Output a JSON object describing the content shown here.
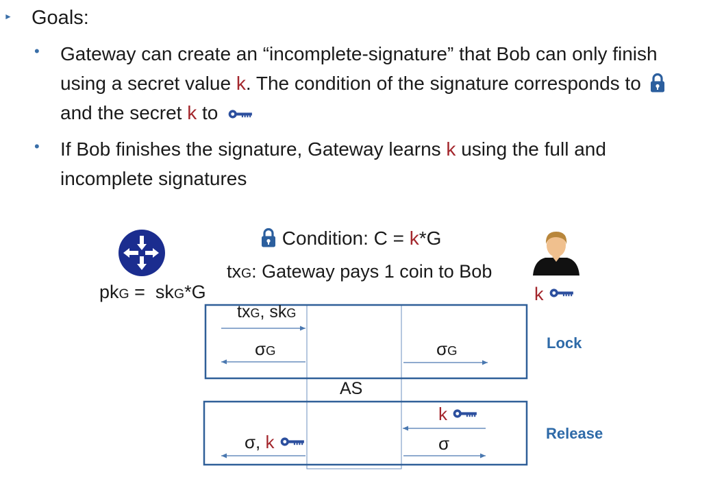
{
  "colors": {
    "accent_blue": "#2e6aa8",
    "var_red": "#a3262c",
    "box_blue": "#3a6aa0",
    "icon_blue": "#2c4f9e",
    "router_blue": "#1b2d8f"
  },
  "bullets": {
    "goals_heading": "Goals:",
    "item1": {
      "part1": "Gateway can create an “incomplete-signature” that Bob can only finish",
      "part2a": "using a secret value ",
      "k": "k",
      "part2b": ". The condition of the signature corresponds to",
      "part3a": "and the secret ",
      "part3b": " to"
    },
    "item2": {
      "part1a": "If Bob finishes the signature, Gateway learns ",
      "k": "k",
      "part1b": " using the full and",
      "part2": "incomplete signatures"
    }
  },
  "diagram": {
    "condition_label": "Condition: C = ",
    "condition_k": "k",
    "condition_rest": "*G",
    "tx_main": "tx",
    "tx_sub": "G",
    "tx_rest": ": Gateway pays 1 coin to Bob",
    "pk_main": "pk",
    "pk_sub": "G",
    "pk_eq": " =  sk",
    "pk_sub2": "G",
    "pk_rest": "*G",
    "bob_k": "k",
    "lock_phase": {
      "msg1_tx": "tx",
      "msg1_tx_sub": "G",
      "msg1_sep": ", sk",
      "msg1_sk_sub": "G",
      "msg2_sigma": "σ",
      "msg2_sub": "G",
      "msg3_sigma": "σ",
      "msg3_sub": "G",
      "label": "Lock"
    },
    "as_label": "AS",
    "release_phase": {
      "msg_k": "k",
      "msg_sigma_right": "σ",
      "msg_left_sigma": "σ, ",
      "msg_left_k": "k",
      "label": "Release"
    }
  },
  "icons": [
    "lock-icon",
    "key-icon",
    "router-icon",
    "user-icon",
    "bullet-triangle-icon"
  ]
}
